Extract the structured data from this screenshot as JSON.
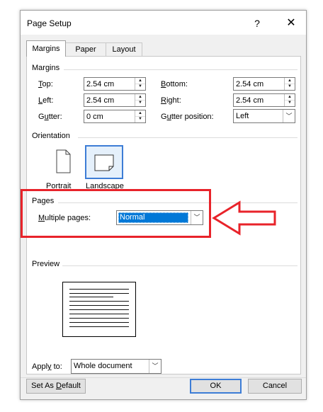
{
  "dialog": {
    "title": "Page Setup",
    "help_label": "?",
    "close_label": "✕"
  },
  "tabs": [
    {
      "label": "Margins",
      "active": true
    },
    {
      "label": "Paper",
      "active": false
    },
    {
      "label": "Layout",
      "active": false
    }
  ],
  "margins": {
    "section": "Margins",
    "top": {
      "accel": "T",
      "rest": "op:",
      "value": "2.54 cm"
    },
    "bottom": {
      "accel": "B",
      "rest": "ottom:",
      "value": "2.54 cm"
    },
    "left": {
      "accel": "L",
      "rest": "eft:",
      "value": "2.54 cm"
    },
    "right": {
      "accel": "R",
      "rest": "ight:",
      "value": "2.54 cm"
    },
    "gutter": {
      "pre": "G",
      "accel": "u",
      "rest": "tter:",
      "value": "0 cm"
    },
    "gutter_position": {
      "pre": "G",
      "accel": "u",
      "rest": "tter position:",
      "value": "Left"
    }
  },
  "orientation": {
    "section": "Orientation",
    "portrait": {
      "pre": "",
      "accel": "P",
      "rest": "ortrait"
    },
    "landscape": {
      "pre": "Land",
      "accel": "s",
      "rest": "cape"
    },
    "selected": "landscape"
  },
  "pages": {
    "section": "Pages",
    "multiple_label_accel": "M",
    "multiple_label_rest": "ultiple pages:",
    "multiple_value": "Normal"
  },
  "preview": {
    "section": "Preview"
  },
  "apply": {
    "label_pre": "Appl",
    "label_accel": "y",
    "label_rest": " to:",
    "value": "Whole document"
  },
  "buttons": {
    "default_pre": "Set As ",
    "default_accel": "D",
    "default_rest": "efault",
    "ok": "OK",
    "cancel": "Cancel"
  },
  "colors": {
    "annotation": "#e8232a",
    "selection": "#0078d7",
    "focus_border": "#3d7dd6"
  }
}
